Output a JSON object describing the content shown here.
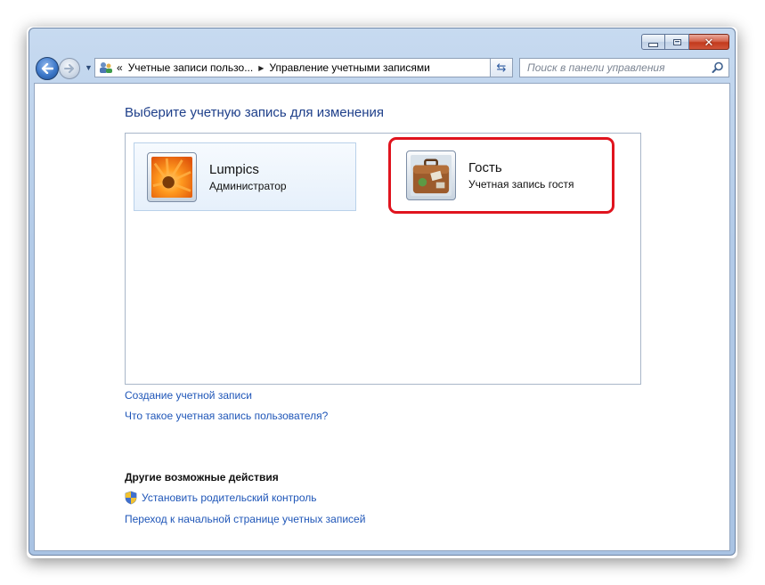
{
  "window": {
    "captions": {
      "minimize": "minimize-icon",
      "maximize": "maximize-icon",
      "close": "close-icon"
    }
  },
  "nav": {
    "breadcrumb_prefix": "«",
    "crumb1": "Учетные записи пользо...",
    "crumb2": "Управление учетными записями",
    "search_placeholder": "Поиск в панели управления"
  },
  "main": {
    "heading": "Выберите учетную запись для изменения",
    "accounts": [
      {
        "name": "Lumpics",
        "role": "Администратор",
        "avatar": "orange-flower-avatar"
      },
      {
        "name": "Гость",
        "role": "Учетная запись гостя",
        "avatar": "suitcase-avatar"
      }
    ],
    "links": {
      "create": "Создание учетной записи",
      "what_is": "Что такое учетная запись пользователя?"
    },
    "other": {
      "heading": "Другие возможные действия",
      "parental": "Установить родительский контроль",
      "goto_accounts": "Переход к начальной странице учетных записей"
    }
  },
  "colors": {
    "heading": "#1e3f8a",
    "link": "#1f56b8",
    "highlight": "#e0141e"
  }
}
